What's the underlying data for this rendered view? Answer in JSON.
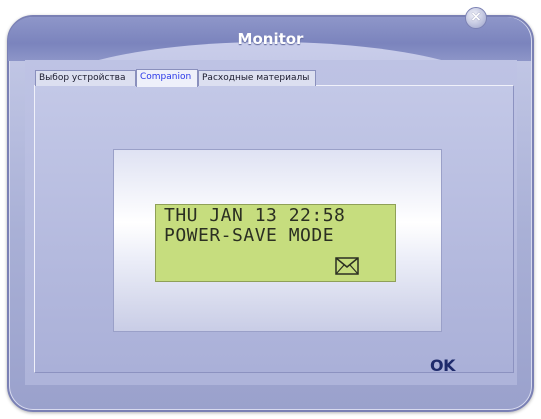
{
  "window": {
    "title": "Monitor"
  },
  "tabs": [
    {
      "label": "Выбор устройства"
    },
    {
      "label": "Companion"
    },
    {
      "label": "Расходные материалы"
    }
  ],
  "display": {
    "line1": "THU JAN 13 22:58",
    "line2": "POWER-SAVE MODE",
    "icon": "envelope-icon",
    "background_color": "#c6dd7e"
  },
  "buttons": {
    "ok_label": "OK",
    "close_label": "×"
  },
  "colors": {
    "accent": "#2a39e8",
    "title_bar": "#7b84bd"
  }
}
